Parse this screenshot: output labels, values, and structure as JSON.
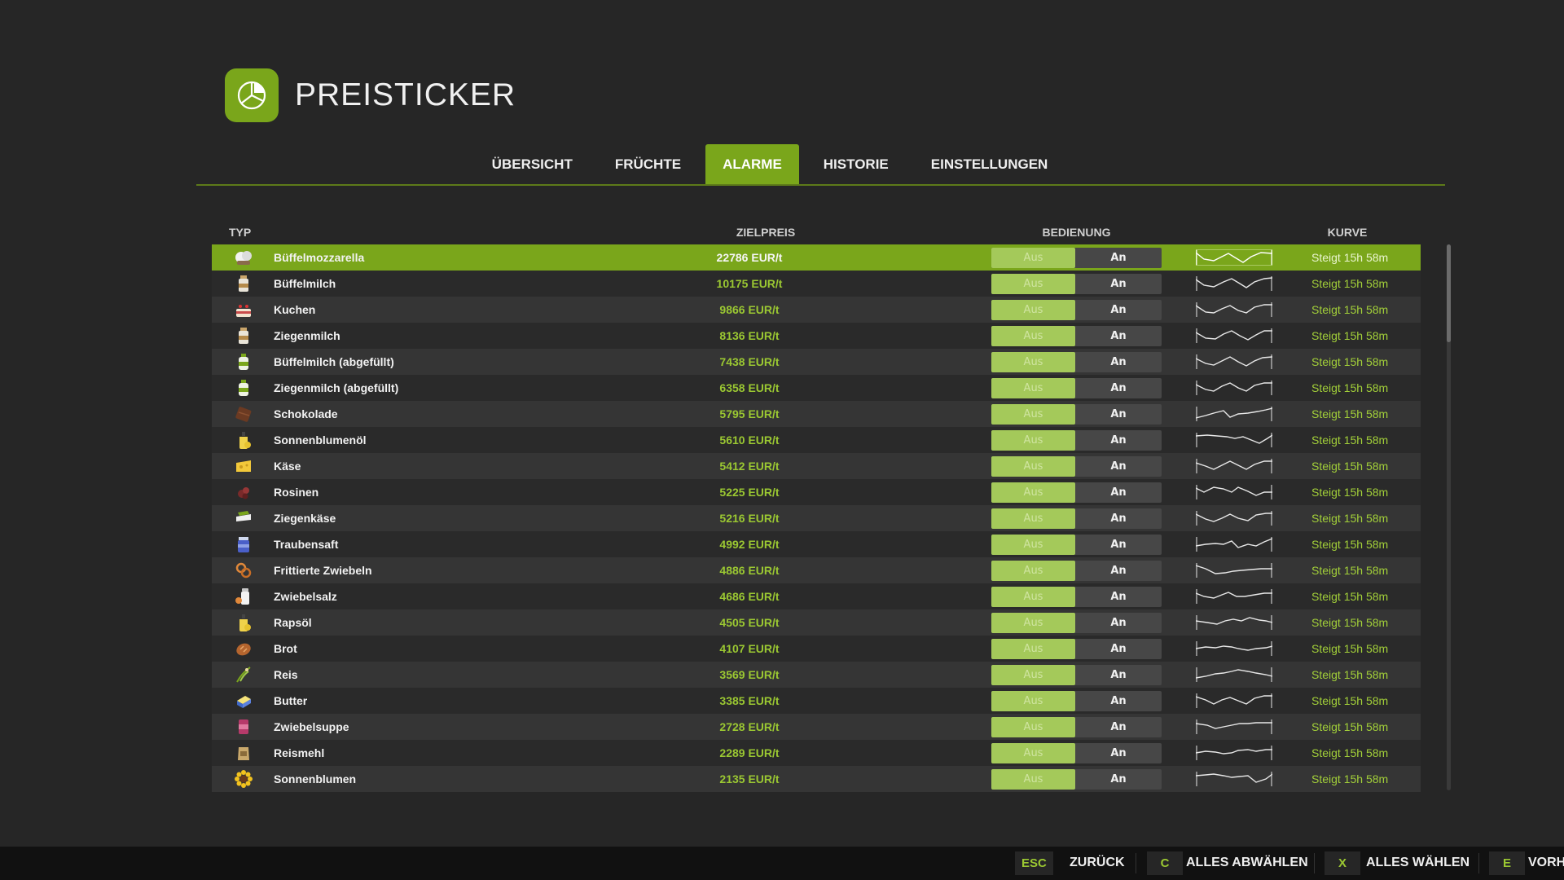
{
  "app": {
    "title": "PREISTICKER",
    "logo_icon": "pie-chart-icon",
    "accent": "#7aa61b"
  },
  "tabs": [
    {
      "label": "ÜBERSICHT",
      "active": false
    },
    {
      "label": "FRÜCHTE",
      "active": false
    },
    {
      "label": "ALARME",
      "active": true
    },
    {
      "label": "HISTORIE",
      "active": false
    },
    {
      "label": "EINSTELLUNGEN",
      "active": false
    }
  ],
  "columns": {
    "type": "TYP",
    "target": "ZIELPREIS",
    "control": "BEDIENUNG",
    "curve": "KURVE"
  },
  "toggle": {
    "off": "Aus",
    "on": "An"
  },
  "rows": [
    {
      "name": "Büffelmozzarella",
      "price": "22786 EUR/t",
      "trend": "Steigt 15h 58m",
      "icon": "mozzarella-icon",
      "selected": true
    },
    {
      "name": "Büffelmilch",
      "price": "10175 EUR/t",
      "trend": "Steigt 15h 58m",
      "icon": "milk-bottle-icon"
    },
    {
      "name": "Kuchen",
      "price": "9866 EUR/t",
      "trend": "Steigt 15h 58m",
      "icon": "cake-icon"
    },
    {
      "name": "Ziegenmilch",
      "price": "8136 EUR/t",
      "trend": "Steigt 15h 58m",
      "icon": "milk-bottle-icon"
    },
    {
      "name": "Büffelmilch (abgefüllt)",
      "price": "7438 EUR/t",
      "trend": "Steigt 15h 58m",
      "icon": "bottle-icon"
    },
    {
      "name": "Ziegenmilch (abgefüllt)",
      "price": "6358 EUR/t",
      "trend": "Steigt 15h 58m",
      "icon": "bottle-icon"
    },
    {
      "name": "Schokolade",
      "price": "5795 EUR/t",
      "trend": "Steigt 15h 58m",
      "icon": "chocolate-icon"
    },
    {
      "name": "Sonnenblumenöl",
      "price": "5610 EUR/t",
      "trend": "Steigt 15h 58m",
      "icon": "oil-bottle-icon"
    },
    {
      "name": "Käse",
      "price": "5412 EUR/t",
      "trend": "Steigt 15h 58m",
      "icon": "cheese-icon"
    },
    {
      "name": "Rosinen",
      "price": "5225 EUR/t",
      "trend": "Steigt 15h 58m",
      "icon": "raisins-icon"
    },
    {
      "name": "Ziegenkäse",
      "price": "5216 EUR/t",
      "trend": "Steigt 15h 58m",
      "icon": "goat-cheese-icon"
    },
    {
      "name": "Traubensaft",
      "price": "4992 EUR/t",
      "trend": "Steigt 15h 58m",
      "icon": "juice-jar-icon"
    },
    {
      "name": "Frittierte Zwiebeln",
      "price": "4886 EUR/t",
      "trend": "Steigt 15h 58m",
      "icon": "onion-rings-icon"
    },
    {
      "name": "Zwiebelsalz",
      "price": "4686 EUR/t",
      "trend": "Steigt 15h 58m",
      "icon": "salt-shaker-icon"
    },
    {
      "name": "Rapsöl",
      "price": "4505 EUR/t",
      "trend": "Steigt 15h 58m",
      "icon": "oil-bottle-icon"
    },
    {
      "name": "Brot",
      "price": "4107 EUR/t",
      "trend": "Steigt 15h 58m",
      "icon": "bread-icon"
    },
    {
      "name": "Reis",
      "price": "3569 EUR/t",
      "trend": "Steigt 15h 58m",
      "icon": "rice-plant-icon"
    },
    {
      "name": "Butter",
      "price": "3385 EUR/t",
      "trend": "Steigt 15h 58m",
      "icon": "butter-icon"
    },
    {
      "name": "Zwiebelsuppe",
      "price": "2728 EUR/t",
      "trend": "Steigt 15h 58m",
      "icon": "soup-can-icon"
    },
    {
      "name": "Reismehl",
      "price": "2289 EUR/t",
      "trend": "Steigt 15h 58m",
      "icon": "flour-bag-icon"
    },
    {
      "name": "Sonnenblumen",
      "price": "2135 EUR/t",
      "trend": "Steigt 15h 58m",
      "icon": "sunflower-icon"
    }
  ],
  "footer": [
    {
      "key": "ESC",
      "label": "ZURÜCK"
    },
    {
      "key": "C",
      "label": "ALLES ABWÄHLEN"
    },
    {
      "key": "X",
      "label": "ALLES WÄHLEN"
    },
    {
      "key": "E",
      "label": "VORH"
    }
  ]
}
